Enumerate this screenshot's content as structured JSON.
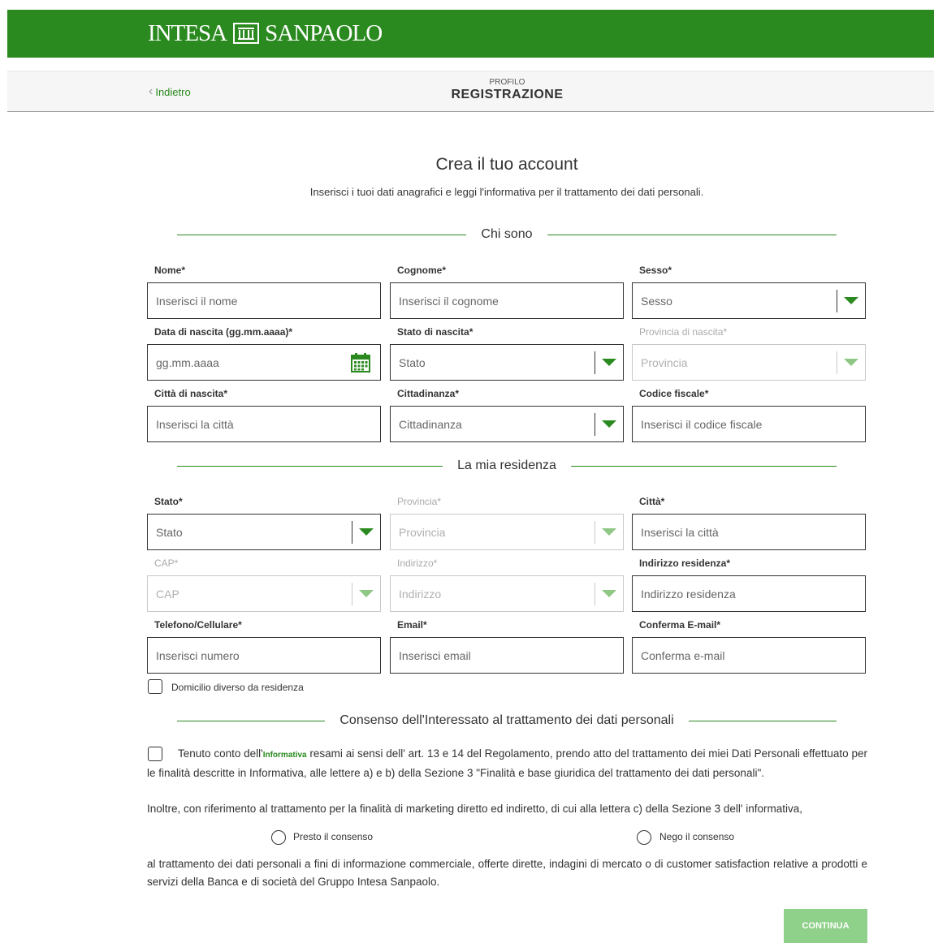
{
  "brand": {
    "left": "INTESA",
    "right": "SANPAOLO"
  },
  "nav": {
    "back_label": "Indietro",
    "section_small": "PROFILO",
    "section_big": "REGISTRAZIONE"
  },
  "header": {
    "title": "Crea il tuo account",
    "subtitle": "Inserisci i tuoi dati anagrafici e leggi l'informativa per il trattamento dei dati personali."
  },
  "sections": {
    "who": "Chi sono",
    "residence": "La mia residenza",
    "consent": "Consenso dell'Interessato al trattamento dei dati personali"
  },
  "fields": {
    "nome": {
      "label": "Nome*",
      "placeholder": "Inserisci il nome"
    },
    "cognome": {
      "label": "Cognome*",
      "placeholder": "Inserisci il cognome"
    },
    "sesso": {
      "label": "Sesso*",
      "placeholder": "Sesso"
    },
    "data_nascita": {
      "label": "Data di nascita (gg.mm.aaaa)*",
      "placeholder": "gg.mm.aaaa"
    },
    "stato_nascita": {
      "label": "Stato di nascita*",
      "placeholder": "Stato"
    },
    "provincia_nascita": {
      "label": "Provincia di nascita*",
      "placeholder": "Provincia"
    },
    "citta_nascita": {
      "label": "Città di nascita*",
      "placeholder": "Inserisci la città"
    },
    "cittadinanza": {
      "label": "Cittadinanza*",
      "placeholder": "Cittadinanza"
    },
    "codice_fiscale": {
      "label": "Codice fiscale*",
      "placeholder": "Inserisci il codice fiscale"
    },
    "stato": {
      "label": "Stato*",
      "placeholder": "Stato"
    },
    "provincia": {
      "label": "Provincia*",
      "placeholder": "Provincia"
    },
    "citta": {
      "label": "Città*",
      "placeholder": "Inserisci la città"
    },
    "cap": {
      "label": "CAP*",
      "placeholder": "CAP"
    },
    "indirizzo": {
      "label": "Indirizzo*",
      "placeholder": "Indirizzo"
    },
    "indirizzo_residenza": {
      "label": "Indirizzo residenza*",
      "placeholder": "Indirizzo residenza"
    },
    "telefono": {
      "label": "Telefono/Cellulare*",
      "placeholder": "Inserisci numero"
    },
    "email": {
      "label": "Email*",
      "placeholder": "Inserisci email"
    },
    "conferma_email": {
      "label": "Conferma E-mail*",
      "placeholder": "Conferma e-mail"
    }
  },
  "domicilio_label": "Domicilio diverso da residenza",
  "consent": {
    "p1_before": "Tenuto conto dell'",
    "p1_link": "Informativa",
    "p1_after": " resami ai sensi dell' art. 13 e 14 del Regolamento, prendo atto del trattamento dei miei Dati Personali effettuato per le finalità descritte in Informativa, alle lettere a) e b) della Sezione 3 \"Finalità e base giuridica del trattamento dei dati personali\".",
    "p2": "Inoltre, con riferimento al trattamento per la finalità di marketing diretto ed indiretto, di cui alla lettera c) della Sezione 3 dell' informativa,",
    "accept_label": "Presto il consenso",
    "deny_label": "Nego il consenso",
    "p3": "al trattamento dei dati personali a fini di informazione commerciale, offerte dirette, indagini di mercato o di customer satisfaction relative a prodotti e servizi della Banca e di società del Gruppo Intesa Sanpaolo."
  },
  "continue_label": "CONTINUA",
  "colors": {
    "brand_green": "#2a8a1f",
    "button_disabled": "#8fd08a"
  }
}
